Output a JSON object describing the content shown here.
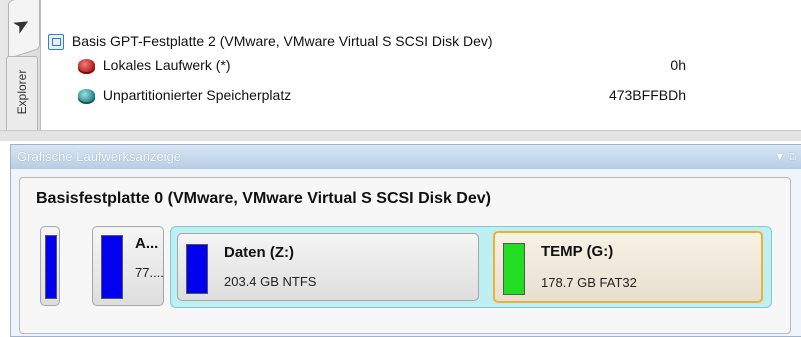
{
  "explorer": {
    "tab_label": "Explorer",
    "rows": [
      {
        "label": "Basis GPT-Festplatte 2 (VMware, VMware Virtual S SCSI Disk Dev)",
        "value": "",
        "icon": "disk-icon"
      },
      {
        "label": "Lokales Laufwerk (*)",
        "value": "0h",
        "icon": "drive-red-icon"
      },
      {
        "label": "Unpartitionierter Speicherplatz",
        "value": "473BFFBDh",
        "icon": "unallocated-drive-icon"
      }
    ]
  },
  "graphic_pane": {
    "title": "Grafische Laufwerksanzeige",
    "disk_title": "Basisfestplatte 0 (VMware, VMware Virtual S SCSI Disk Dev)",
    "partitions": [
      {
        "name": "",
        "info": "",
        "color": "#0000ee"
      },
      {
        "name": "A...",
        "info": "77....",
        "color": "#0000ee"
      },
      {
        "name": "Daten (Z:)",
        "info": "203.4 GB NTFS",
        "color": "#0000ee"
      },
      {
        "name": "TEMP (G:)",
        "info": "178.7 GB FAT32",
        "color": "#22dd22",
        "selected": true
      }
    ]
  },
  "colors": {
    "accent": "#f0b030",
    "header": "#b7cde5",
    "extended": "#bdeff3"
  }
}
